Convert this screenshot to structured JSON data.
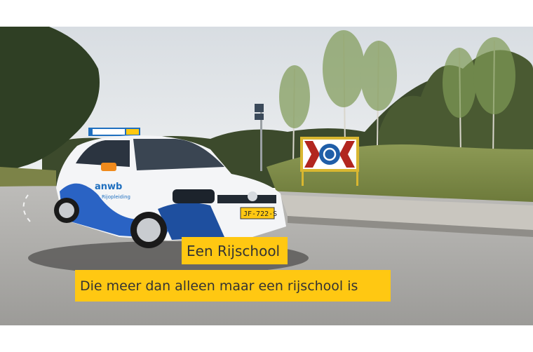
{
  "hero": {
    "caption_title": "Een Rijschool",
    "caption_subtitle": "Die meer dan alleen maar een rijschool is",
    "car_branding": "anwb",
    "car_branding_sub": "Rijopleiding",
    "license_plate": "JF-722-S",
    "accent_color": "#ffc812"
  }
}
